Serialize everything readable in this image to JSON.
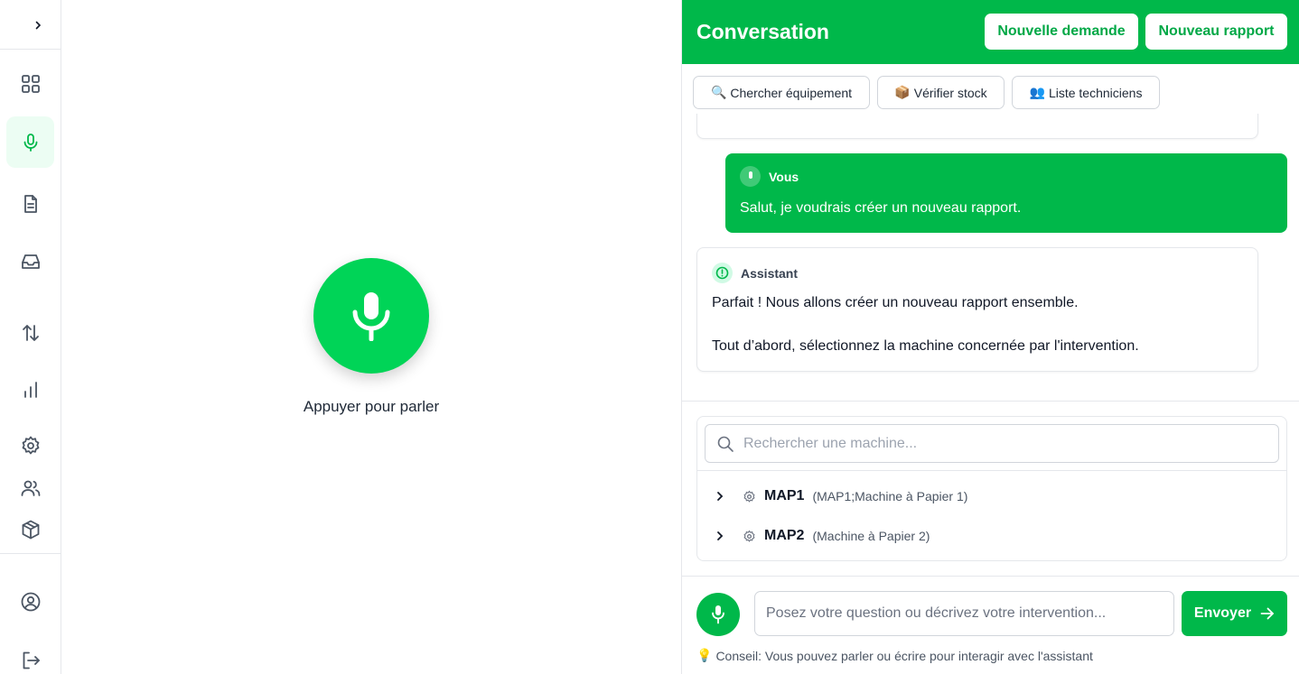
{
  "voice": {
    "label": "Appuyer pour parler"
  },
  "panel": {
    "title": "Conversation",
    "buttons": {
      "new_request": "Nouvelle demande",
      "new_report": "Nouveau rapport"
    },
    "quick_actions": [
      {
        "icon": "🔍",
        "label": "Chercher équipement"
      },
      {
        "icon": "📦",
        "label": "Vérifier stock"
      },
      {
        "icon": "👥",
        "label": "Liste techniciens"
      }
    ],
    "messages": {
      "user": {
        "author": "Vous",
        "text": "Salut, je voudrais créer un nouveau rapport."
      },
      "assistant": {
        "author": "Assistant",
        "line1": "Parfait ! Nous allons créer un nouveau rapport ensemble.",
        "line2": "Tout d’abord, sélectionnez la machine concernée par l'intervention."
      }
    },
    "machine_picker": {
      "placeholder": "Rechercher une machine...",
      "machines": [
        {
          "name": "MAP1",
          "description": "(MAP1;Machine à Papier 1)"
        },
        {
          "name": "MAP2",
          "description": "(Machine à Papier 2)"
        }
      ]
    },
    "composer": {
      "placeholder": "Posez votre question ou décrivez votre intervention...",
      "send_label": "Envoyer",
      "tip_icon": "💡",
      "tip": "Conseil: Vous pouvez parler ou écrire pour interagir avec l'assistant"
    }
  },
  "colors": {
    "accent": "#00b84a",
    "mic_bright": "#00d457"
  }
}
